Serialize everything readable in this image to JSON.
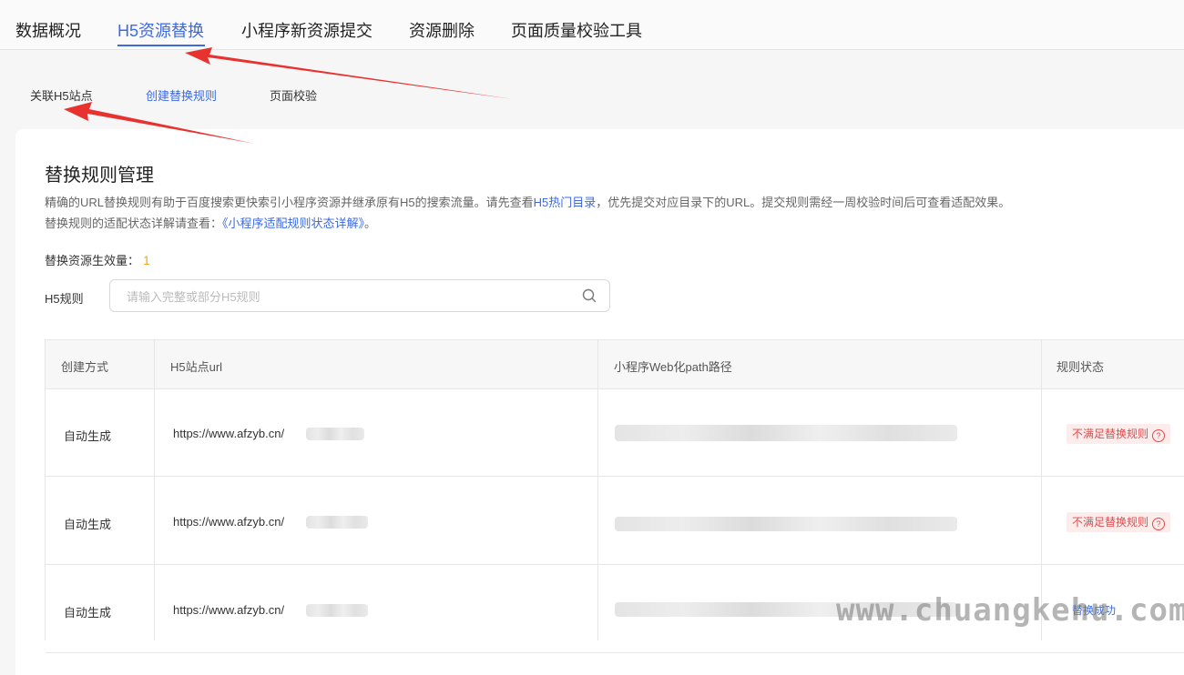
{
  "top_tabs": [
    {
      "label": "数据概况"
    },
    {
      "label": "H5资源替换"
    },
    {
      "label": "小程序新资源提交"
    },
    {
      "label": "资源删除"
    },
    {
      "label": "页面质量校验工具"
    }
  ],
  "sub_tabs": [
    {
      "label": "关联H5站点"
    },
    {
      "label": "创建替换规则"
    },
    {
      "label": "页面校验"
    }
  ],
  "card": {
    "title": "替换规则管理",
    "desc1_a": "精确的URL替换规则有助于百度搜索更快索引小程序资源并继承原有H5的搜索流量。请先查看",
    "desc1_link": "H5热门目录",
    "desc1_b": "，优先提交对应目录下的URL。提交规则需经一周校验时间后可查看适配效果。",
    "desc2_a": "替换规则的适配状态详解请查看：",
    "desc2_link": "《小程序适配规则状态详解》",
    "desc2_b": "。",
    "count_label": "替换资源生效量：",
    "count_value": "1",
    "filter_label": "H5规则",
    "search_placeholder": "请输入完整或部分H5规则"
  },
  "table": {
    "headers": [
      "创建方式",
      "H5站点url",
      "小程序Web化path路径",
      "规则状态"
    ],
    "rows": [
      {
        "method": "自动生成",
        "url": "https://www.afzyb.cn/",
        "status": "不满足替换规则"
      },
      {
        "method": "自动生成",
        "url": "https://www.afzyb.cn/",
        "status": "不满足替换规则"
      },
      {
        "method": "自动生成",
        "url": "https://www.afzyb.cn/",
        "status": "替换成功"
      }
    ]
  },
  "watermark": "www.chuangkehu.com",
  "colors": {
    "accent": "#3d6ae0",
    "warning": "#f5a623",
    "error": "#e24b4b",
    "arrow": "#e8322f"
  }
}
